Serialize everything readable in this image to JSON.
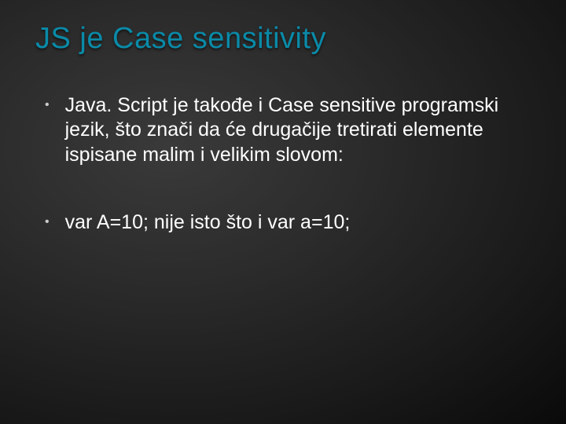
{
  "slide": {
    "title": "JS je Case sensitivity",
    "bullets": [
      "Java. Script je takođe i Case sensitive programski jezik, što znači da će drugačije tretirati elemente ispisane malim i velikim slovom:",
      "var A=10; nije isto što i var a=10;"
    ]
  }
}
